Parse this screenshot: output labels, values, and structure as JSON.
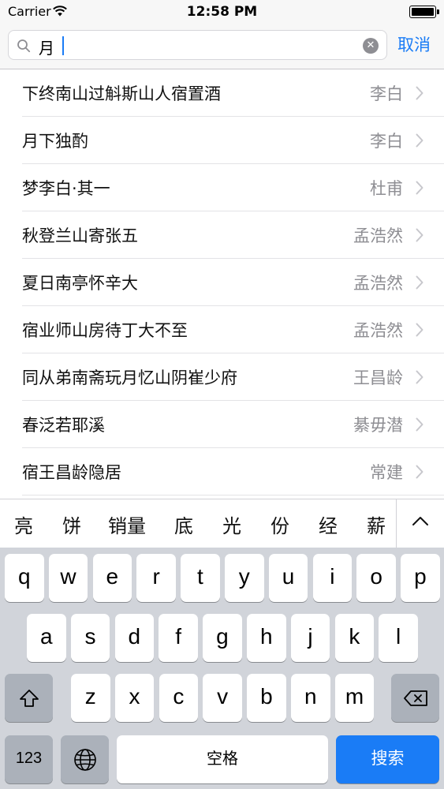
{
  "status_bar": {
    "carrier": "Carrier",
    "time": "12:58 PM",
    "battery_level": 1.0
  },
  "search": {
    "query": "月",
    "cancel_label": "取消"
  },
  "results": [
    {
      "title": "下终南山过斛斯山人宿置酒",
      "author": "李白"
    },
    {
      "title": "月下独酌",
      "author": "李白"
    },
    {
      "title": "梦李白·其一",
      "author": "杜甫"
    },
    {
      "title": "秋登兰山寄张五",
      "author": "孟浩然"
    },
    {
      "title": "夏日南亭怀辛大",
      "author": "孟浩然"
    },
    {
      "title": "宿业师山房待丁大不至",
      "author": "孟浩然"
    },
    {
      "title": "同从弟南斋玩月忆山阴崔少府",
      "author": "王昌龄"
    },
    {
      "title": "春泛若耶溪",
      "author": "綦毋潜"
    },
    {
      "title": "宿王昌龄隐居",
      "author": "常建"
    }
  ],
  "candidates": [
    "亮",
    "饼",
    "销量",
    "底",
    "光",
    "份",
    "经",
    "薪"
  ],
  "keyboard": {
    "row1": [
      "q",
      "w",
      "e",
      "r",
      "t",
      "y",
      "u",
      "i",
      "o",
      "p"
    ],
    "row2": [
      "a",
      "s",
      "d",
      "f",
      "g",
      "h",
      "j",
      "k",
      "l"
    ],
    "row3": [
      "z",
      "x",
      "c",
      "v",
      "b",
      "n",
      "m"
    ],
    "numbers_label": "123",
    "space_label": "空格",
    "search_label": "搜索"
  },
  "colors": {
    "accent": "#1a7cf6",
    "secondary_text": "#8e8e93",
    "keyboard_bg": "#d1d4da"
  }
}
